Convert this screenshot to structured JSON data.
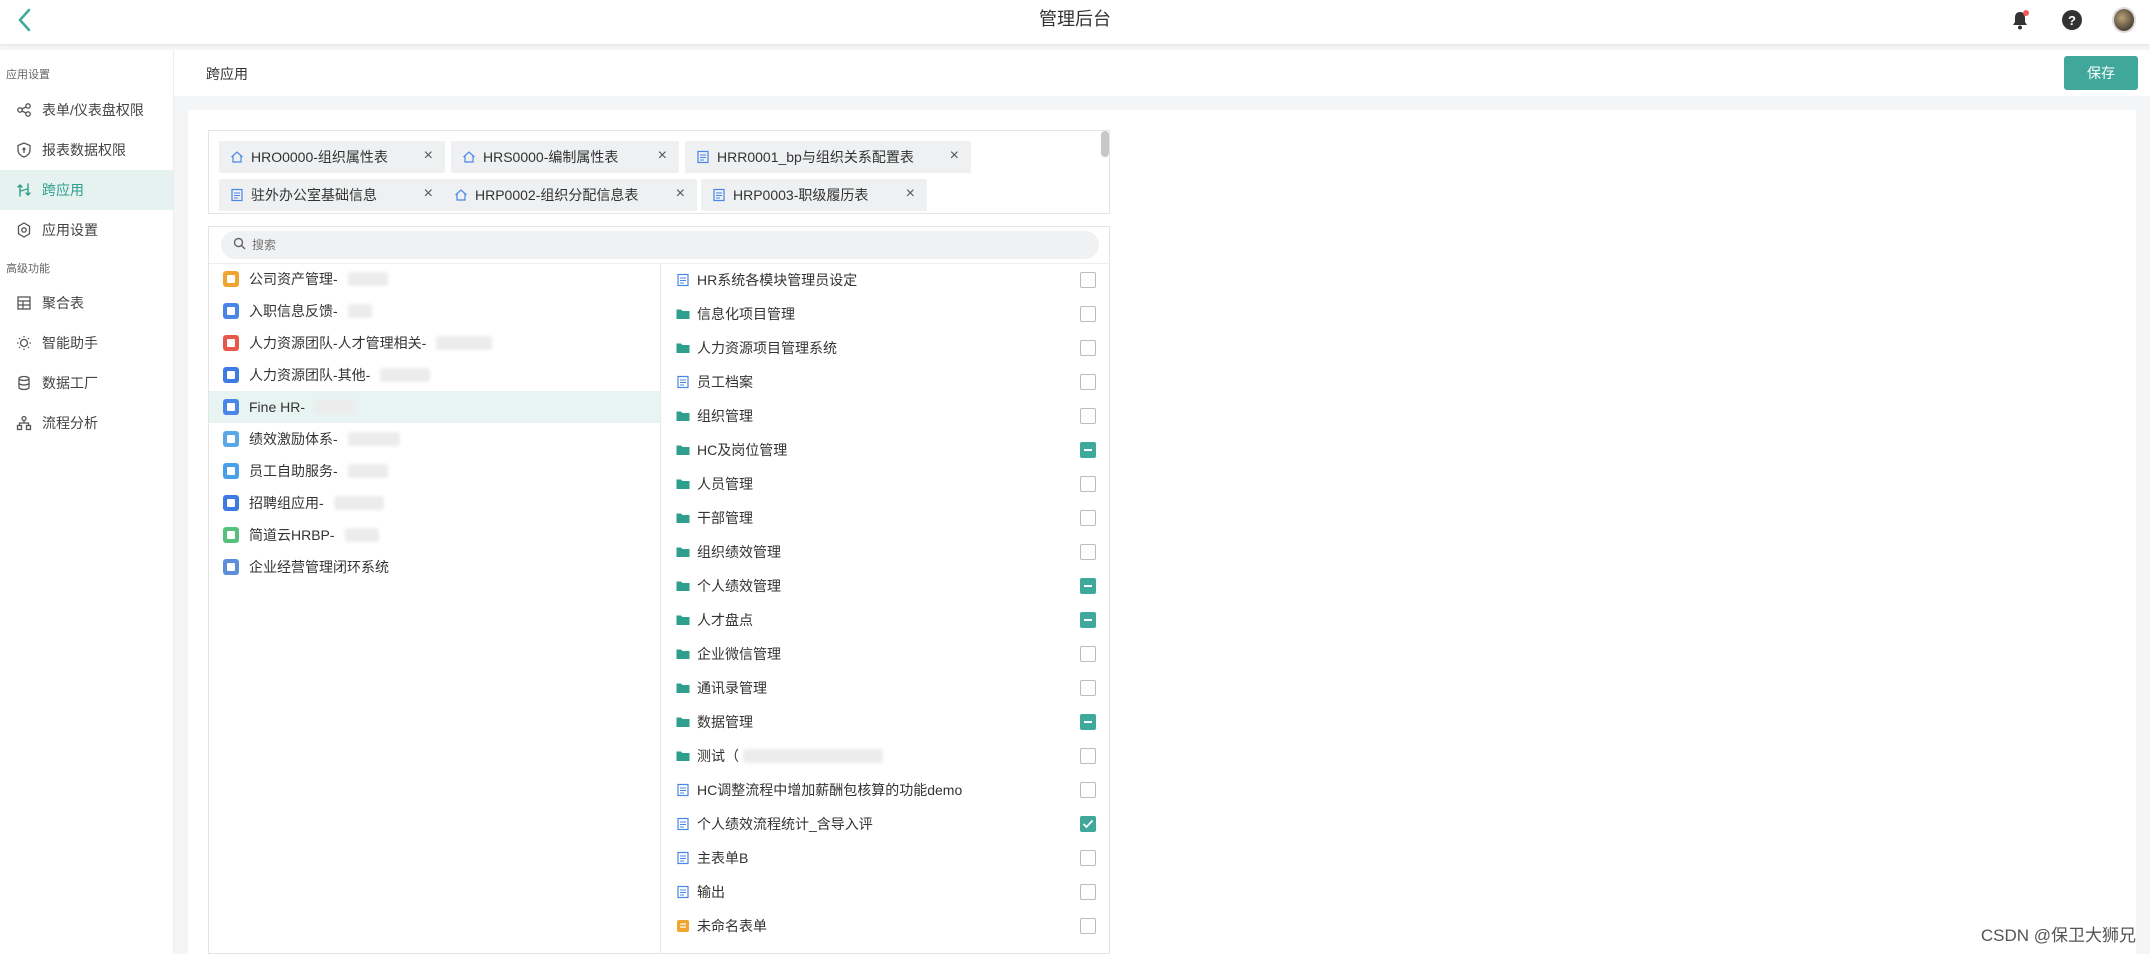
{
  "header": {
    "title": "管理后台"
  },
  "sidebar": {
    "section_app": "应用设置",
    "section_advanced": "高级功能",
    "items": [
      {
        "label": "表单/仪表盘权限",
        "icon": "share-icon"
      },
      {
        "label": "报表数据权限",
        "icon": "shield-icon"
      },
      {
        "label": "跨应用",
        "icon": "cross-app-icon",
        "active": true
      },
      {
        "label": "应用设置",
        "icon": "gear-icon"
      }
    ],
    "advanced_items": [
      {
        "label": "聚合表",
        "icon": "table-icon"
      },
      {
        "label": "智能助手",
        "icon": "bulb-icon"
      },
      {
        "label": "数据工厂",
        "icon": "database-icon"
      },
      {
        "label": "流程分析",
        "icon": "flow-icon"
      }
    ]
  },
  "content": {
    "title": "跨应用",
    "save_label": "保存"
  },
  "tags": [
    {
      "label": "HRO0000-组织属性表",
      "icon": "home-icon"
    },
    {
      "label": "HRS0000-编制属性表",
      "icon": "home-icon"
    },
    {
      "label": "HRR0001_bp与组织关系配置表",
      "icon": "form-icon"
    },
    {
      "label": "驻外办公室基础信息",
      "icon": "form-icon"
    },
    {
      "label": "HRP0002-组织分配信息表",
      "icon": "home-icon"
    },
    {
      "label": "HRP0003-职级履历表",
      "icon": "form-icon"
    }
  ],
  "search": {
    "placeholder": "搜索"
  },
  "apps": [
    {
      "label": "公司资产管理-",
      "color": "#f0a531"
    },
    {
      "label": "入职信息反馈-",
      "color": "#4a86e8"
    },
    {
      "label": "人力资源团队-人才管理相关-",
      "color": "#e8574a"
    },
    {
      "label": "人力资源团队-其他-",
      "color": "#3d7be0"
    },
    {
      "label": "Fine HR-",
      "color": "#4a86e8",
      "active": true
    },
    {
      "label": "绩效激励体系-",
      "color": "#5aa7e8"
    },
    {
      "label": "员工自助服务-",
      "color": "#4aa0e8"
    },
    {
      "label": "招聘组应用-",
      "color": "#3d7be0"
    },
    {
      "label": "简道云HRBP-",
      "color": "#57c17b"
    },
    {
      "label": "企业经营管理闭环系统",
      "color": "#5b8fd9"
    }
  ],
  "forms": [
    {
      "label": "HR系统各模块管理员设定",
      "type": "form",
      "state": "unchecked"
    },
    {
      "label": "信息化项目管理",
      "type": "folder",
      "state": "unchecked"
    },
    {
      "label": "人力资源项目管理系统",
      "type": "folder",
      "state": "unchecked"
    },
    {
      "label": "员工档案",
      "type": "form",
      "state": "unchecked"
    },
    {
      "label": "组织管理",
      "type": "folder",
      "state": "unchecked"
    },
    {
      "label": "HC及岗位管理",
      "type": "folder",
      "state": "partial"
    },
    {
      "label": "人员管理",
      "type": "folder",
      "state": "unchecked"
    },
    {
      "label": "干部管理",
      "type": "folder",
      "state": "unchecked"
    },
    {
      "label": "组织绩效管理",
      "type": "folder",
      "state": "unchecked"
    },
    {
      "label": "个人绩效管理",
      "type": "folder",
      "state": "partial"
    },
    {
      "label": "人才盘点",
      "type": "folder",
      "state": "partial"
    },
    {
      "label": "企业微信管理",
      "type": "folder",
      "state": "unchecked"
    },
    {
      "label": "通讯录管理",
      "type": "folder",
      "state": "unchecked"
    },
    {
      "label": "数据管理",
      "type": "folder",
      "state": "partial"
    },
    {
      "label": "测试（",
      "type": "folder",
      "state": "unchecked",
      "blurred": true
    },
    {
      "label": "HC调整流程中增加薪酬包核算的功能demo",
      "type": "form",
      "state": "unchecked"
    },
    {
      "label": "个人绩效流程统计_含导入评",
      "type": "form",
      "state": "checked"
    },
    {
      "label": "主表单B",
      "type": "form",
      "state": "unchecked"
    },
    {
      "label": "输出",
      "type": "form",
      "state": "unchecked"
    },
    {
      "label": "未命名表单",
      "type": "app-form",
      "state": "unchecked"
    }
  ],
  "colors": {
    "accent": "#3fa89a",
    "active_bg": "#e5f2f0"
  },
  "watermark": "CSDN @保卫大狮兄"
}
